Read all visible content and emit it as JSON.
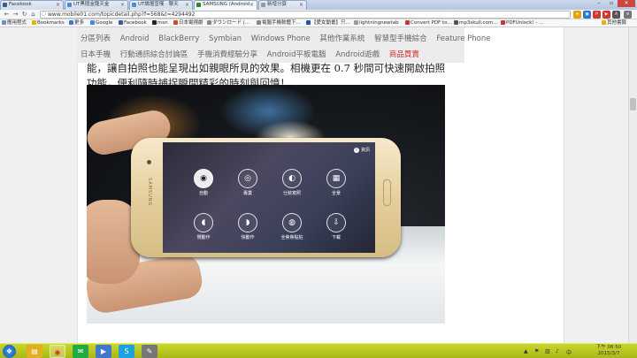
{
  "browser": {
    "tabs": [
      {
        "title": "Facebook",
        "color": "#3b5998"
      },
      {
        "title": "UT黑悶金龍天金",
        "color": "#4c8bd6"
      },
      {
        "title": "UT論壇宣嘆 · 聊天",
        "color": "#4c8bd6"
      },
      {
        "title": "SAMSUNG (Android",
        "color": "#2f8a2f"
      },
      {
        "title": "新增分頁",
        "color": "#888888"
      }
    ],
    "url": "www.mobile01.com/topicdetail.php?f=568&t=4294492",
    "bookmarks": [
      {
        "label": "應用程式",
        "color": "#6d8fd0"
      },
      {
        "label": "Bookmarks",
        "color": "#e4b400"
      },
      {
        "label": "更多",
        "color": "#3a7ad5"
      },
      {
        "label": "Google",
        "color": "#4285f4"
      },
      {
        "label": "Facebook",
        "color": "#3b5998"
      },
      {
        "label": "msn",
        "color": "#222222"
      },
      {
        "label": "日本電視劇",
        "color": "#d04a2a"
      },
      {
        "label": "ダウンロード |…",
        "color": "#888888"
      },
      {
        "label": "電腦手機軟體下…",
        "color": "#888888"
      },
      {
        "label": "【愛女動畫】只…",
        "color": "#2255aa"
      },
      {
        "label": "lightningnewtab",
        "color": "#999999"
      },
      {
        "label": "Convert PDF to…",
        "color": "#cc3333"
      },
      {
        "label": "mp3skull.com…",
        "color": "#555555"
      },
      {
        "label": "PDFUnlock! - …",
        "color": "#cc3333"
      },
      {
        "label": "其他書籤",
        "color": "#e4b400"
      }
    ]
  },
  "forum_nav": {
    "row1": [
      "分區列表",
      "Android",
      "BlackBerry",
      "Symbian",
      "Windows Phone",
      "其他作業系統",
      "智慧型手機綜合",
      "Feature Phone"
    ],
    "row2": [
      "日本手機",
      "行動通訊綜合討論區",
      "手機消費經驗分享",
      "Android平板電腦",
      "Android遊戲"
    ],
    "hot": "商品買賣"
  },
  "article": {
    "line1": "能，讓自拍照也能呈現出如親眼所見的效果。相機更在 0.7 秒間可快速開啟拍照",
    "line2": "功能，便利隨時捕捉瞬間精彩的時刻與回憶！"
  },
  "photo": {
    "brand": "SAMSUNG",
    "info_label": "資訊",
    "modes": [
      {
        "icon": "◉",
        "label": "自動",
        "selected": true
      },
      {
        "icon": "◎",
        "label": "專業",
        "selected": false
      },
      {
        "icon": "◐",
        "label": "仕裝寫照",
        "selected": false
      },
      {
        "icon": "▦",
        "label": "全景",
        "selected": false
      },
      {
        "icon": "◖",
        "label": "慢動作",
        "selected": false
      },
      {
        "icon": "◗",
        "label": "快動作",
        "selected": false
      },
      {
        "icon": "◍",
        "label": "全焦焦點拍",
        "selected": false
      },
      {
        "icon": "⇩",
        "label": "下載",
        "selected": false
      }
    ]
  },
  "taskbar": {
    "apps": [
      {
        "icon": "❖",
        "color": "#2d7ad6"
      },
      {
        "icon": "▤",
        "color": "#e0b020"
      },
      {
        "icon": "◉",
        "color": "#dd3322"
      },
      {
        "icon": "✉",
        "color": "#22aa44"
      },
      {
        "icon": "▶",
        "color": "#4477cc"
      },
      {
        "icon": "S",
        "color": "#1aa3e0"
      },
      {
        "icon": "✎",
        "color": "#777777"
      }
    ],
    "time": "下午 08:50",
    "date": "2015/3/7"
  }
}
